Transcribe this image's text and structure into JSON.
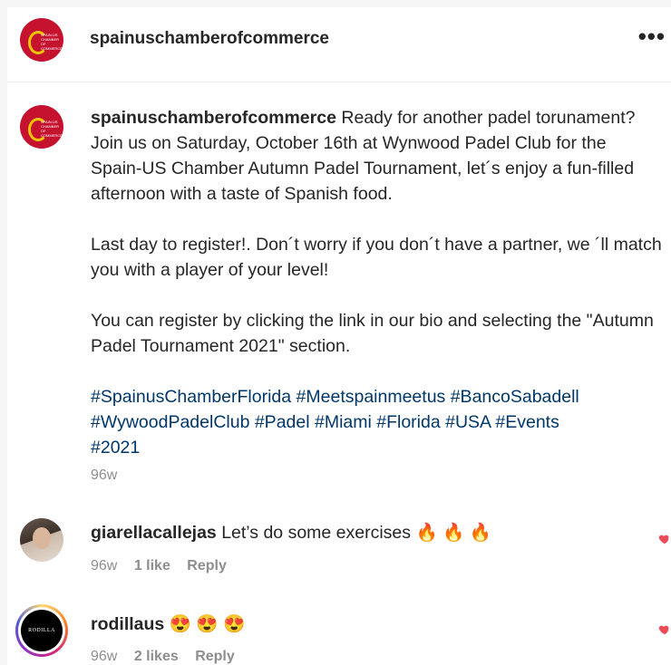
{
  "header": {
    "username": "spainuschamberofcommerce",
    "more_icon": "more-horizontal-icon",
    "avatar_lines": [
      "SPAIN-US",
      "CHAMBER OF",
      "COMMERCE"
    ]
  },
  "post": {
    "username": "spainuschamberofcommerce",
    "caption_para1": "Ready for another padel torunament? Join us on Saturday, October 16th at Wynwood Padel Club for the Spain-US Chamber Autumn Padel Tournament, let´s enjoy a fun-filled afternoon with a taste of Spanish food.",
    "caption_para2": "Last day to register!. Don´t worry if you don´t have a partner, we ´ll match you with a player of your level!",
    "caption_para3": "You can register by clicking the link in our bio and selecting the \"Autumn Padel Tournament 2021\" section.",
    "hashtags_line1": "#SpainusChamberFlorida #Meetspainmeetus #BancoSabadell",
    "hashtags_line2": "#WywoodPadelClub #Padel #Miami #Florida #USA #Events",
    "hashtags_line3": "#2021",
    "time": "96w"
  },
  "comments": [
    {
      "username": "giarellacallejas",
      "text": "Let’s do some exercises",
      "emoji": "🔥 🔥 🔥",
      "time": "96w",
      "likes": "1 like",
      "reply": "Reply"
    },
    {
      "username": "rodillaus",
      "text": "",
      "emoji": "😍 😍 😍",
      "time": "96w",
      "likes": "2 likes",
      "reply": "Reply",
      "avatar_text": "RODILLA"
    }
  ],
  "colors": {
    "brand_red": "#c4122f",
    "brand_gold": "#f3c500",
    "hashtag": "#00376b",
    "heart": "#ed4956"
  }
}
